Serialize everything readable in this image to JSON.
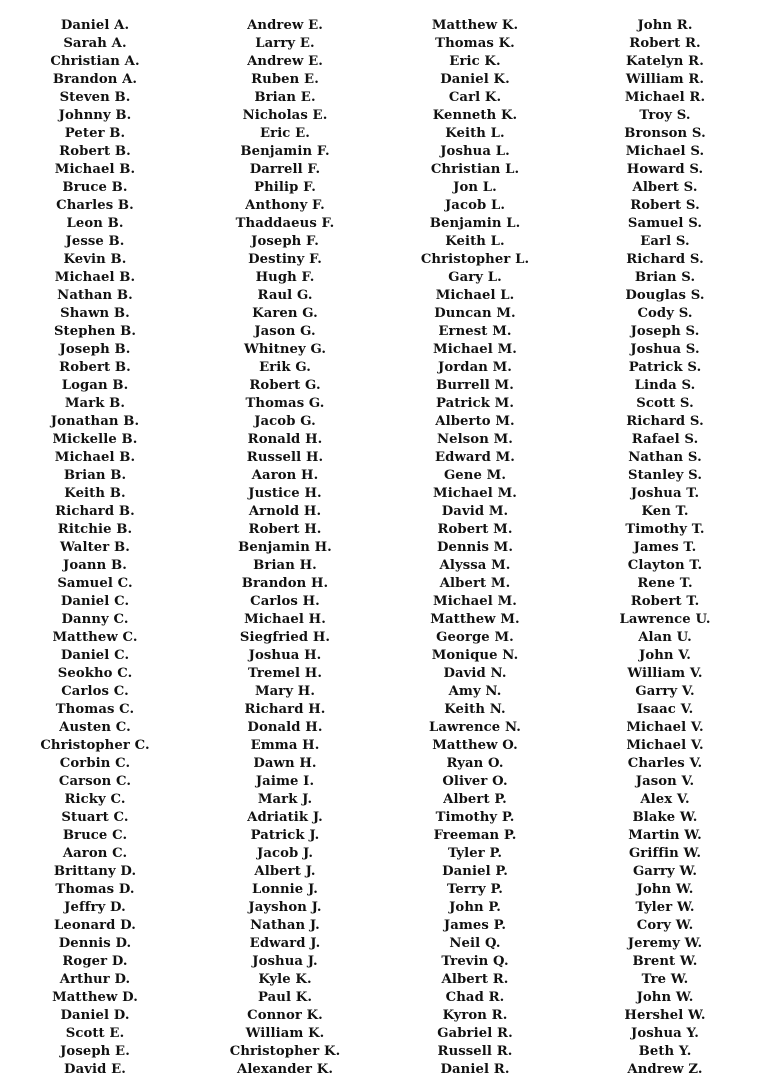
{
  "document": {
    "type": "name-list",
    "layout": "four-column",
    "column_count": 4,
    "row_count": 57,
    "text_color": "#111111",
    "background_color": "#ffffff"
  },
  "columns": [
    {
      "index": 1,
      "names": [
        "Daniel A.",
        "Sarah A.",
        "Christian A.",
        "Brandon A.",
        "Steven B.",
        "Johnny B.",
        "Peter B.",
        "Robert B.",
        "Michael B.",
        "Bruce B.",
        "Charles B.",
        "Leon B.",
        "Jesse B.",
        "Kevin B.",
        "Michael B.",
        "Nathan B.",
        "Shawn B.",
        "Stephen B.",
        "Joseph B.",
        "Robert B.",
        "Logan B.",
        "Mark B.",
        "Jonathan B.",
        "Mickelle B.",
        "Michael B.",
        "Brian B.",
        "Keith B.",
        "Richard B.",
        "Ritchie B.",
        "Walter B.",
        "Joann B.",
        "Samuel C.",
        "Daniel C.",
        "Danny C.",
        "Matthew C.",
        "Daniel C.",
        "Seokho C.",
        "Carlos C.",
        "Thomas C.",
        "Austen C.",
        "Christopher C.",
        "Corbin C.",
        "Carson C.",
        "Ricky C.",
        "Stuart C.",
        "Bruce C.",
        "Aaron C.",
        "Brittany D.",
        "Thomas D.",
        "Jeffry D.",
        "Leonard D.",
        "Dennis D.",
        "Roger D.",
        "Arthur D.",
        "Matthew D.",
        "Daniel D.",
        "Scott E.",
        "Joseph E.",
        "David E."
      ]
    },
    {
      "index": 2,
      "names": [
        "Andrew E.",
        "Larry E.",
        "Andrew E.",
        "Ruben E.",
        "Brian E.",
        "Nicholas E.",
        "Eric E.",
        "Benjamin F.",
        "Darrell F.",
        "Philip F.",
        "Anthony F.",
        "Thaddaeus F.",
        "Joseph F.",
        "Destiny F.",
        "Hugh F.",
        "Raul G.",
        "Karen G.",
        "Jason G.",
        "Whitney G.",
        "Erik G.",
        "Robert G.",
        "Thomas G.",
        "Jacob G.",
        "Ronald H.",
        "Russell H.",
        "Aaron H.",
        "Justice H.",
        "Arnold H.",
        "Robert H.",
        "Benjamin H.",
        "Brian H.",
        "Brandon H.",
        "Carlos H.",
        "Michael H.",
        "Siegfried H.",
        "Joshua H.",
        "Tremel H.",
        "Mary H.",
        "Richard H.",
        "Donald H.",
        "Emma H.",
        "Dawn H.",
        "Jaime I.",
        "Mark J.",
        "Adriatik J.",
        "Patrick J.",
        "Jacob J.",
        "Albert J.",
        "Lonnie J.",
        "Jayshon J.",
        "Nathan J.",
        "Edward J.",
        "Joshua J.",
        "Kyle K.",
        "Paul K.",
        "Connor K.",
        "William K.",
        "Christopher K.",
        "Alexander K."
      ]
    },
    {
      "index": 3,
      "names": [
        "Matthew K.",
        "Thomas K.",
        "Eric K.",
        "Daniel K.",
        "Carl K.",
        "Kenneth K.",
        "Keith L.",
        "Joshua L.",
        "Christian L.",
        "Jon L.",
        "Jacob L.",
        "Benjamin L.",
        "Keith L.",
        "Christopher L.",
        "Gary L.",
        "Michael L.",
        "Duncan M.",
        "Ernest M.",
        "Michael M.",
        "Jordan M.",
        "Burrell M.",
        "Patrick M.",
        "Alberto M.",
        "Nelson M.",
        "Edward M.",
        "Gene M.",
        "Michael M.",
        "David M.",
        "Robert M.",
        "Dennis M.",
        "Alyssa M.",
        "Albert M.",
        "Michael M.",
        "Matthew M.",
        "George M.",
        "Monique N.",
        "David N.",
        "Amy N.",
        "Keith N.",
        "Lawrence N.",
        "Matthew O.",
        "Ryan O.",
        "Oliver O.",
        "Albert P.",
        "Timothy P.",
        "Freeman P.",
        "Tyler P.",
        "Daniel P.",
        "Terry P.",
        "John P.",
        "James P.",
        "Neil Q.",
        "Trevin Q.",
        "Albert R.",
        "Chad R.",
        "Kyron R.",
        "Gabriel R.",
        "Russell R.",
        "Daniel R."
      ]
    },
    {
      "index": 4,
      "names": [
        "John R.",
        "Robert R.",
        "Katelyn R.",
        "William R.",
        "Michael R.",
        "Troy S.",
        "Bronson S.",
        "Michael S.",
        "Howard S.",
        "Albert S.",
        "Robert S.",
        "Samuel S.",
        "Earl S.",
        "Richard S.",
        "Brian S.",
        "Douglas S.",
        "Cody S.",
        "Joseph S.",
        "Joshua S.",
        "Patrick S.",
        "Linda S.",
        "Scott S.",
        "Richard S.",
        "Rafael S.",
        "Nathan S.",
        "Stanley S.",
        "Joshua T.",
        "Ken T.",
        "Timothy T.",
        "James T.",
        "Clayton T.",
        "Rene T.",
        "Robert T.",
        "Lawrence U.",
        "Alan U.",
        "John V.",
        "William V.",
        "Garry V.",
        "Isaac V.",
        "Michael V.",
        "Michael V.",
        "Charles V.",
        "Jason V.",
        "Alex V.",
        "Blake W.",
        "Martin W.",
        "Griffin W.",
        "Garry W.",
        "John W.",
        "Tyler W.",
        "Cory W.",
        "Jeremy W.",
        "Brent W.",
        "Tre W.",
        "John W.",
        "Hershel W.",
        "Joshua Y.",
        "Beth Y.",
        "Andrew Z."
      ]
    }
  ]
}
